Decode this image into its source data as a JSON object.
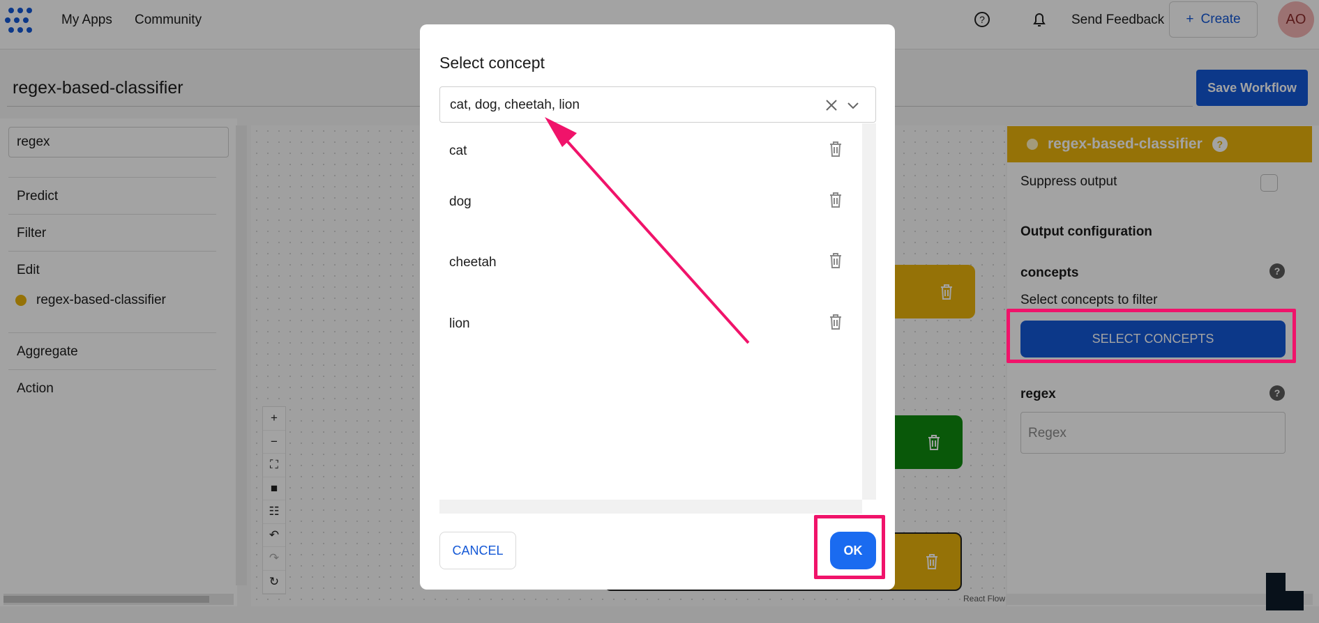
{
  "nav": {
    "links": [
      "My Apps",
      "Community"
    ],
    "send_feedback": "Send Feedback",
    "create": "Create",
    "avatar": "AO"
  },
  "workflow": {
    "title": "regex-based-classifier",
    "save_label": "Save Workflow"
  },
  "left_panel": {
    "search_value": "regex",
    "categories": [
      "Predict",
      "Filter",
      "Edit",
      "Aggregate",
      "Action"
    ],
    "model_item": "regex-based-classifier"
  },
  "canvas": {
    "react_flow_label": "React Flow"
  },
  "right_panel": {
    "header": "regex-based-classifier",
    "suppress_output": "Suppress output",
    "output_configuration": "Output configuration",
    "concepts_label": "concepts",
    "concepts_hint": "Select concepts to filter",
    "select_concepts_button": "SELECT CONCEPTS",
    "regex_label": "regex",
    "regex_placeholder": "Regex"
  },
  "modal": {
    "title": "Select concept",
    "selected_value": "cat, dog, cheetah, lion",
    "items": [
      "cat",
      "dog",
      "cheetah",
      "lion"
    ],
    "cancel": "CANCEL",
    "ok": "OK"
  },
  "colors": {
    "primary": "#1458d6",
    "highlight": "#f0136a",
    "node_yellow": "#e9b30c",
    "node_green": "#0f8a0f"
  }
}
